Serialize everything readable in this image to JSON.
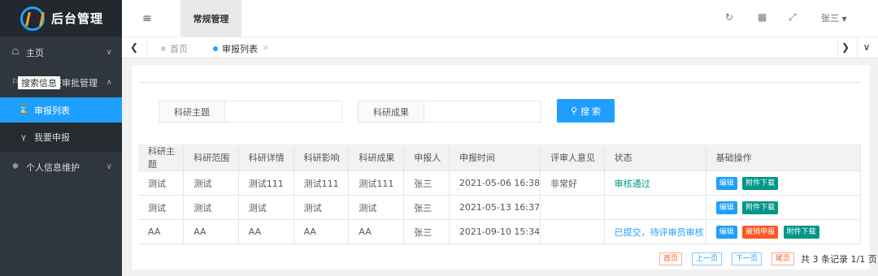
{
  "app": {
    "title": "后台管理"
  },
  "sidebar": {
    "items": [
      {
        "label": "主页",
        "icon": "home-icon"
      },
      {
        "label": "项目申报审批管理",
        "icon": "flag-icon"
      },
      {
        "label": "审报列表",
        "icon": "hourglass-icon"
      },
      {
        "label": "我要申报",
        "icon": "v-icon"
      },
      {
        "label": "个人信息维护",
        "icon": "snowflake-icon"
      }
    ]
  },
  "topbar": {
    "tab": "常规管理",
    "user": "张三"
  },
  "tabs": [
    {
      "label": "首页"
    },
    {
      "label": "审报列表"
    }
  ],
  "search": {
    "legend": "搜索信息",
    "field1_label": "科研主题",
    "field1_value": "",
    "field2_label": "科研成果",
    "field2_value": "",
    "button": "搜 索"
  },
  "table": {
    "headers": [
      "科研主题",
      "科研范围",
      "科研详情",
      "科研影响",
      "科研成果",
      "申报人",
      "申报时间",
      "评审人意见",
      "状态",
      "基础操作"
    ],
    "rows": [
      [
        "测试",
        "测试",
        "测试111",
        "测试111",
        "测试111",
        "张三",
        "2021-05-06 16:38",
        "非常好",
        "审核通过"
      ],
      [
        "测试",
        "测试",
        "测试",
        "测试",
        "测试",
        "张三",
        "2021-05-13 16:37",
        "",
        ""
      ],
      [
        "AA",
        "AA",
        "AA",
        "AA",
        "AA",
        "张三",
        "2021-09-10 15:34",
        "",
        "已提交，待评审员审核"
      ]
    ],
    "actions": {
      "edit": "编辑",
      "download": "附件下载",
      "revoke": "撤销申报"
    }
  },
  "pager": {
    "first": "首页",
    "prev": "上一页",
    "next": "下一页",
    "last": "尾页",
    "info": "共 3 条记录 1/1 页"
  },
  "colors": {
    "accent": "#1e9fff",
    "success": "#009688",
    "danger": "#ff5722",
    "sidebar": "#2f363d"
  }
}
